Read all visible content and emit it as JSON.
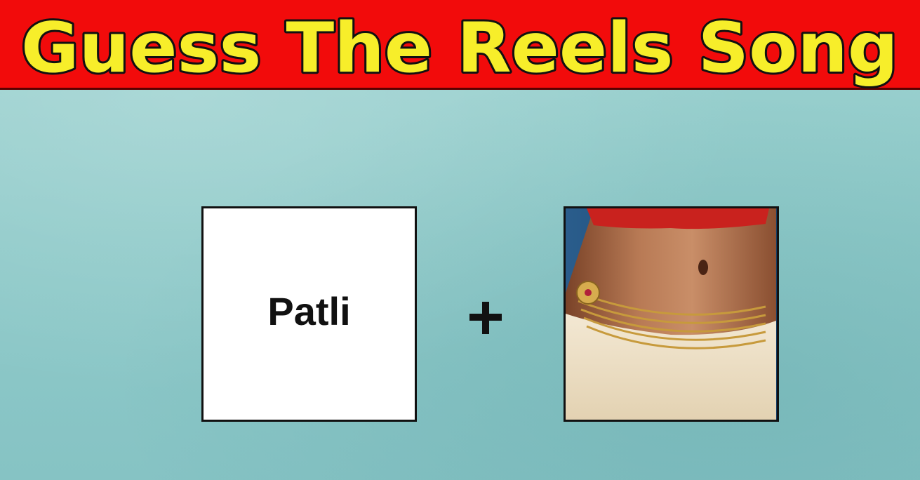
{
  "header": {
    "title": "Guess The Reels Song"
  },
  "puzzle": {
    "clue_word": "Patli",
    "operator": "+",
    "clue_image": "waist-belly-chain-icon"
  },
  "colors": {
    "banner": "#f20b0b",
    "title_fill": "#f7ee2a",
    "background": "#8ec9c8"
  }
}
